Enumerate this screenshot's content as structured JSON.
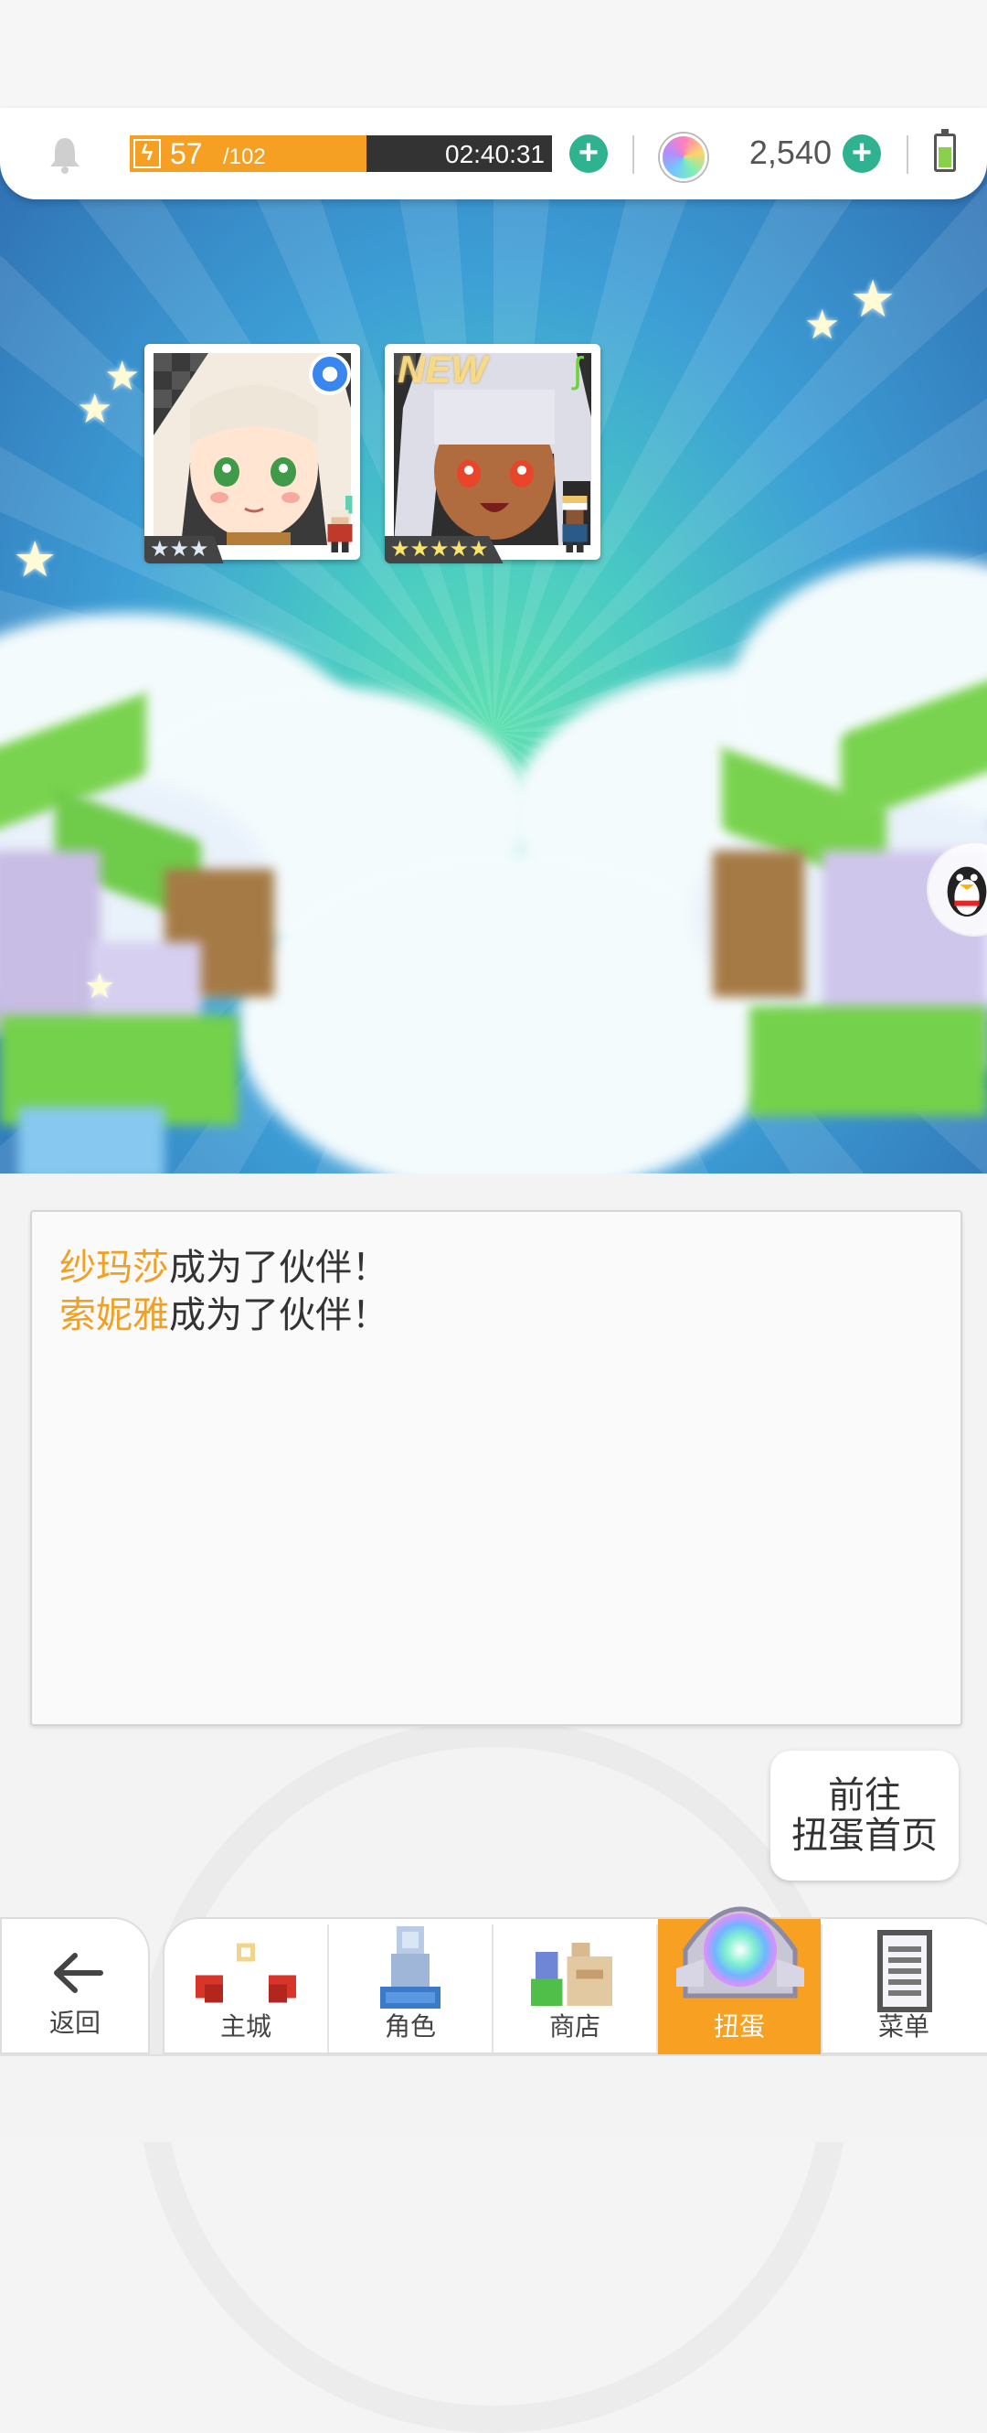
{
  "header": {
    "stamina_current": "57",
    "stamina_max": "/102",
    "stamina_fraction": 0.56,
    "timer": "02:40:31",
    "gems": "2,540",
    "accent_color": "#f5a023",
    "plus_color": "#2fb28f"
  },
  "cards": [
    {
      "stars": "★★★",
      "badge": "circle-badge"
    },
    {
      "stars": "★★★★★",
      "badge": "leaf-badge",
      "new_label": "NEW"
    }
  ],
  "messages": [
    {
      "name": "纱玛莎",
      "text": "成为了伙伴！"
    },
    {
      "name": "索妮雅",
      "text": "成为了伙伴！"
    }
  ],
  "goto_button": {
    "line1": "前往",
    "line2": "扭蛋首页"
  },
  "nav": {
    "back": "返回",
    "items": [
      "主城",
      "角色",
      "商店",
      "扭蛋",
      "菜单"
    ],
    "active_index": 3
  }
}
